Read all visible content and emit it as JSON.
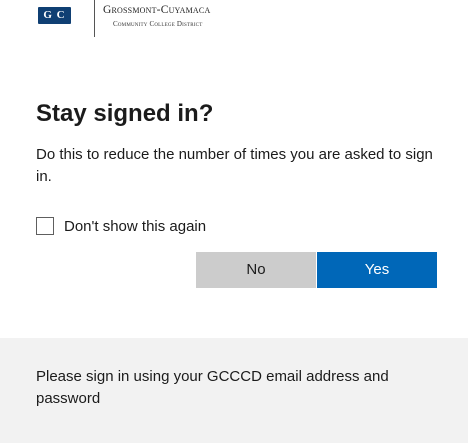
{
  "branding": {
    "logo_mark": "G C",
    "org_name": "Grossmont-Cuyamaca",
    "org_subtitle": "Community College District",
    "accent_color": "#0f3f73"
  },
  "dialog": {
    "title": "Stay signed in?",
    "description": "Do this to reduce the number of times you are asked to sign in.",
    "checkbox": {
      "label": "Don't show this again",
      "checked": false
    },
    "buttons": {
      "no_label": "No",
      "yes_label": "Yes",
      "primary_color": "#0067b8",
      "secondary_color": "#cccccc"
    }
  },
  "footer": {
    "text": "Please sign in using your GCCCD email address and password"
  }
}
